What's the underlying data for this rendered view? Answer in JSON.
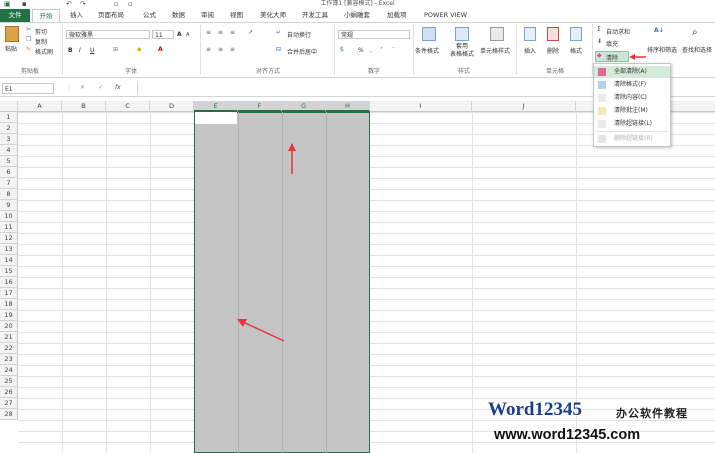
{
  "window": {
    "title": "工作簿1 [兼容模式] - Excel"
  },
  "tabs": [
    "文件",
    "开始",
    "插入",
    "页面布局",
    "公式",
    "数据",
    "审阅",
    "视图",
    "美化大师",
    "开发工具",
    "小蜗雕套",
    "加载项",
    "POWER VIEW"
  ],
  "clipboard": {
    "paste": "粘贴",
    "cut": "剪切",
    "copy": "复制",
    "format_painter": "格式刷",
    "group": "剪贴板"
  },
  "font": {
    "name": "微软雅黑",
    "size": "11",
    "bold": "B",
    "italic": "I",
    "underline": "U",
    "group": "字体",
    "grow": "A",
    "shrink": "A"
  },
  "alignment": {
    "wrap": "自动换行",
    "merge": "合并后居中",
    "group": "对齐方式"
  },
  "number": {
    "format": "常规",
    "percent": "%",
    "group": "数字"
  },
  "styles": {
    "conditional": "条件格式",
    "table": "套用\n表格格式",
    "cell": "单元格样式",
    "group": "样式"
  },
  "cells": {
    "insert": "插入",
    "delete": "删除",
    "format": "格式",
    "group": "单元格"
  },
  "editing": {
    "autosum": "自动求和",
    "fill": "填充",
    "clear": "清除",
    "sort": "排序和筛选",
    "find": "查找和选择"
  },
  "clear_menu": [
    "全部清除(A)",
    "清除格式(F)",
    "清除内容(C)",
    "清除批注(M)",
    "清除超链接(L)",
    "删除超链接(R)"
  ],
  "namebox": "E1",
  "formula_icons": {
    "cancel": "✕",
    "enter": "✓",
    "fx": "fx"
  },
  "columns": [
    "A",
    "B",
    "C",
    "D",
    "E",
    "F",
    "G",
    "H",
    "I",
    "J"
  ],
  "rows": [
    "1",
    "2",
    "3",
    "4",
    "5",
    "6",
    "7",
    "8",
    "9",
    "10",
    "11",
    "12",
    "13",
    "14",
    "15",
    "16",
    "17",
    "18",
    "19",
    "20",
    "21",
    "22",
    "23",
    "24",
    "25",
    "26",
    "27",
    "28"
  ],
  "watermark": {
    "brand": "Word12345",
    "tag": "办公软件教程",
    "url": "www.word12345.com"
  },
  "colors": {
    "accent": "#217346",
    "selection": "#c5c5c5",
    "arrow": "#e8323c"
  }
}
